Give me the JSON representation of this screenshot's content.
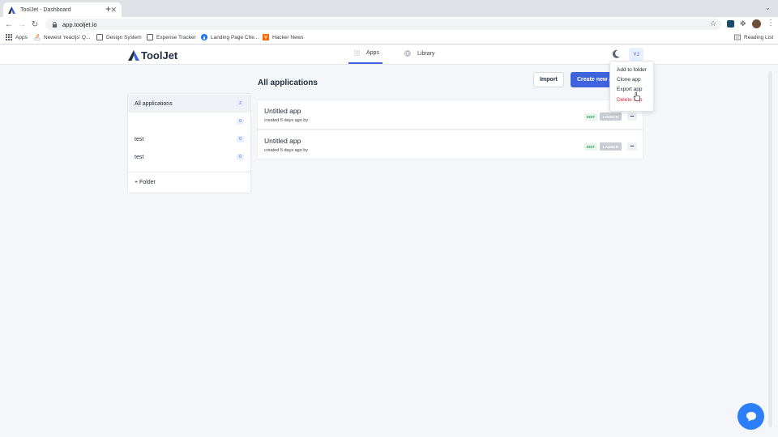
{
  "browser": {
    "tab_title": "ToolJet - Dashboard",
    "url": "app.tooljet.io",
    "bookmarks": [
      "Apps",
      "Newest 'reactjs' Q...",
      "Design System",
      "Expense Tracker",
      "Landing Page Che...",
      "Hacker News"
    ],
    "reading_list": "Reading List"
  },
  "header": {
    "logo": "ToolJet",
    "tabs": [
      {
        "label": "Apps"
      },
      {
        "label": "Library"
      }
    ],
    "avatar": "YJ"
  },
  "main": {
    "title": "All applications",
    "import_label": "Import",
    "create_label": "Create new app"
  },
  "sidebar": {
    "folders": [
      {
        "name": "All applications",
        "count": "2"
      },
      {
        "name": "",
        "count": "0"
      },
      {
        "name": "test",
        "count": "0"
      },
      {
        "name": "test",
        "count": "0"
      }
    ],
    "add_folder": "+ Folder"
  },
  "apps": [
    {
      "name": "Untitled app",
      "meta": "created 5 days ago by",
      "edit": "EDIT",
      "launch": "LAUNCH"
    },
    {
      "name": "Untitled app",
      "meta": "created 5 days ago by",
      "edit": "EDIT",
      "launch": "LAUNCH"
    }
  ],
  "menu": {
    "items": [
      "Add to folder",
      "Clone app",
      "Export app",
      "Delete app"
    ]
  },
  "colors": {
    "accent": "#3e63dd",
    "danger": "#d72d39",
    "chat": "#2d7ff9"
  }
}
